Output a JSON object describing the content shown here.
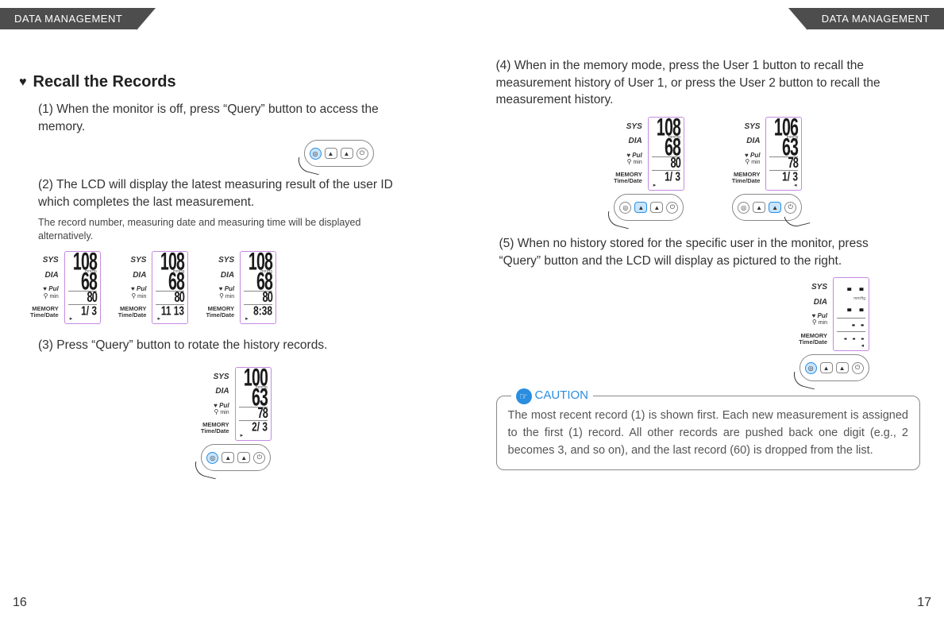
{
  "header": {
    "left": "DATA MANAGEMENT",
    "right": "DATA MANAGEMENT"
  },
  "page_left_num": "16",
  "page_right_num": "17",
  "section": {
    "title": "Recall the Records",
    "step1": "(1) When the monitor is off, press “Query” button to access the memory.",
    "step2a": "(2) The LCD will display the latest measuring result of the user ID which completes the last measurement.",
    "step2b": "The record number, measuring date and measuring time will be displayed alternatively.",
    "step3": "(3) Press “Query” button to rotate the history records.",
    "step4": "(4) When in the memory mode, press the User 1 button to recall the measurement history of User 1, or press the User 2 button to recall the measurement history.",
    "step5": "(5) When no history stored for the specific user in the monitor, press “Query” button and the LCD will display as pictured to the right."
  },
  "labels": {
    "sys": "SYS",
    "dia": "DIA",
    "pul": "Pul",
    "pul_sub": "min",
    "mem1": "MEMORY",
    "mem2": "Time/Date",
    "mmhg": "mmHg"
  },
  "screens": {
    "a": {
      "sys": "108",
      "dia": "68",
      "pul": "80",
      "mem": "1/  3"
    },
    "b": {
      "sys": "108",
      "dia": "68",
      "pul": "80",
      "mem": "11  13"
    },
    "c": {
      "sys": "108",
      "dia": "68",
      "pul": "80",
      "mem": "8:38"
    },
    "d": {
      "sys": "100",
      "dia": "63",
      "pul": "78",
      "mem": "2/  3"
    },
    "e": {
      "sys": "108",
      "dia": "68",
      "pul": "80",
      "mem": "1/  3"
    },
    "f": {
      "sys": "106",
      "dia": "63",
      "pul": "78",
      "mem": "1/  3"
    },
    "g": {
      "sys": "- -",
      "dia": "- -",
      "pul": "- -",
      "mem": "- - -"
    }
  },
  "caution": {
    "label": "CAUTION",
    "text": "The most recent record (1) is shown first.  Each new measurement is assigned to the first (1) record. All other records are pushed back one digit (e.g., 2 becomes 3, and so on), and the last record (60) is dropped from the list."
  }
}
